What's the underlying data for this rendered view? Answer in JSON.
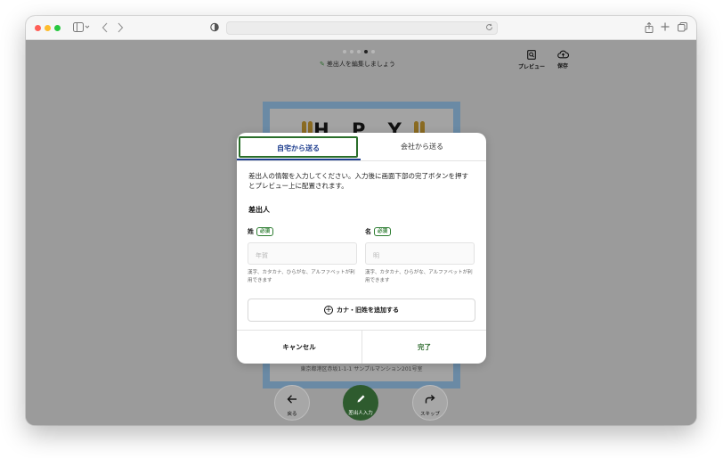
{
  "colors": {
    "accent_green": "#2e6b2e",
    "tab_blue": "#1f3f8f",
    "card_frame": "#6a8aa5"
  },
  "browser": {
    "icons": [
      "sidebar-icon",
      "back-icon",
      "forward-icon",
      "shield-icon",
      "reload-icon",
      "share-icon",
      "new-tab-icon",
      "tabs-overview-icon"
    ]
  },
  "editor": {
    "page_indicator": {
      "total": 5,
      "current": 4
    },
    "hint": "差出人を編集しましょう",
    "preview_label": "プレビュー",
    "save_label": "保存"
  },
  "card": {
    "title": "H P Y",
    "address_line": "東京都港区赤坂1-1-1 サンプルマンション201号室"
  },
  "nav": {
    "back_label": "戻る",
    "sender_label": "差出人入力",
    "skip_label": "スキップ"
  },
  "modal": {
    "tabs": [
      {
        "label": "自宅から送る"
      },
      {
        "label": "会社から送る"
      }
    ],
    "description": "差出人の情報を入力してください。入力後に画面下部の完了ボタンを押すとプレビュー上に配置されます。",
    "section_title": "差出人",
    "required_badge": "必須",
    "last_name": {
      "label": "姓",
      "placeholder": "年賀",
      "hint": "漢字、カタカナ、ひらがな、アルファベットが利用できます"
    },
    "first_name": {
      "label": "名",
      "placeholder": "明",
      "hint": "漢字、カタカナ、ひらがな、アルファベットが利用できます"
    },
    "add_kana_label": "カナ・旧姓を追加する",
    "cancel_label": "キャンセル",
    "done_label": "完了"
  }
}
